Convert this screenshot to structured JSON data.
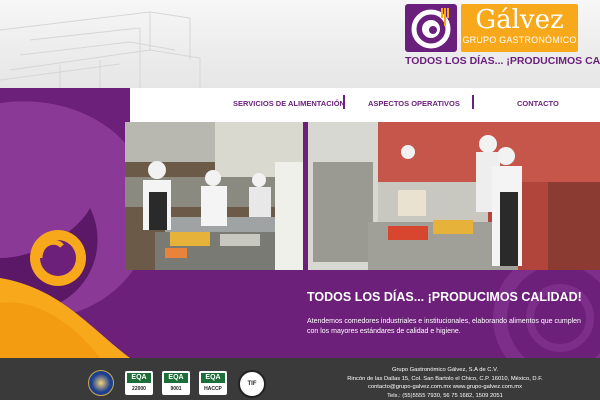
{
  "logo": {
    "name": "Gálvez",
    "subtitle": "GRUPO GASTRONÓMICO",
    "tagline": "TODOS LOS DÍAS... ¡PRODUCIMOS CALIDAD!"
  },
  "nav": {
    "items": [
      {
        "label": "SERVICIOS DE ALIMENTACIÓN"
      },
      {
        "label": "ASPECTOS OPERATIVOS"
      },
      {
        "label": "CONTACTO"
      }
    ]
  },
  "main": {
    "headline": "TODOS LOS DÍAS... ¡PRODUCIMOS CALIDAD!",
    "description": "Atendemos comedores industriales e institucionales, elaborando alimentos que cumplen con los mayores estándares de calidad e higiene."
  },
  "footer": {
    "certifications": [
      {
        "top": "EQA",
        "bottom": "22000"
      },
      {
        "top": "EQA",
        "bottom": "9001"
      },
      {
        "top": "EQA",
        "bottom": "HACCP"
      }
    ],
    "tif_label": "TIF",
    "company": "Grupo Gastronómico Gálvez, S.A de C.V.",
    "address": "Rincón de las Dallas 15, Col. San Bartolo el Chico, C.P. 16010, México, D.F.",
    "contact": "contacto@grupo-galvez.com.mx www.grupo-galvez.com.mx",
    "phones": "Tels.: (55)5555 7930, 56 75 1682, 1509 2051"
  },
  "colors": {
    "purple": "#6c2079",
    "orange": "#f7a81b",
    "footer": "#3a3a3a"
  }
}
